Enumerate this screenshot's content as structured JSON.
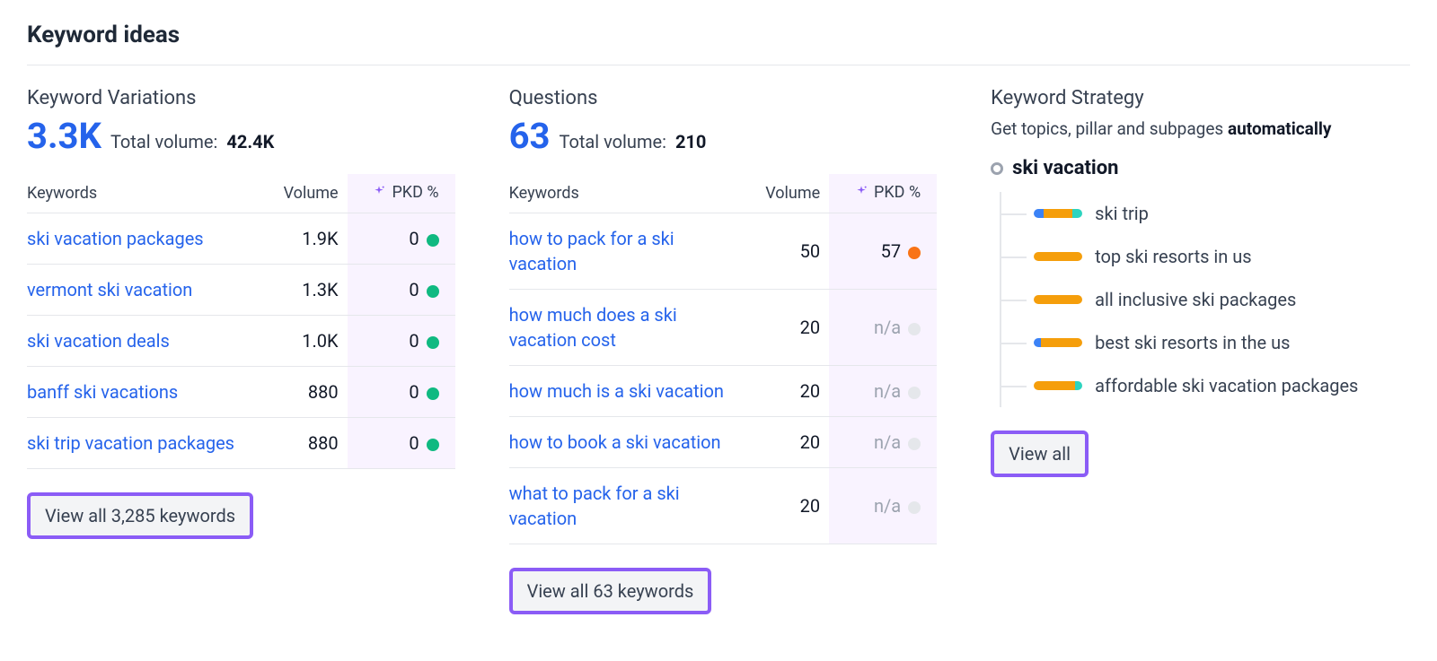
{
  "colors": {
    "dot_green": "#10b981",
    "dot_orange": "#f97316",
    "dot_gray": "#e5e7eb",
    "pkd_bg": "#f9f3ff",
    "accent_purple": "#8b5cf6",
    "link_blue": "#2563eb"
  },
  "page_title": "Keyword ideas",
  "variations": {
    "title": "Keyword Variations",
    "count": "3.3K",
    "total_label": "Total volume:",
    "total_value": "42.4K",
    "columns": {
      "keywords": "Keywords",
      "volume": "Volume",
      "pkd": "PKD %"
    },
    "rows": [
      {
        "keyword": "ski vacation packages",
        "volume": "1.9K",
        "pkd": "0",
        "dot": "green"
      },
      {
        "keyword": "vermont ski vacation",
        "volume": "1.3K",
        "pkd": "0",
        "dot": "green"
      },
      {
        "keyword": "ski vacation deals",
        "volume": "1.0K",
        "pkd": "0",
        "dot": "green"
      },
      {
        "keyword": "banff ski vacations",
        "volume": "880",
        "pkd": "0",
        "dot": "green"
      },
      {
        "keyword": "ski trip vacation packages",
        "volume": "880",
        "pkd": "0",
        "dot": "green"
      }
    ],
    "view_all": "View all 3,285 keywords"
  },
  "questions": {
    "title": "Questions",
    "count": "63",
    "total_label": "Total volume:",
    "total_value": "210",
    "columns": {
      "keywords": "Keywords",
      "volume": "Volume",
      "pkd": "PKD %"
    },
    "rows": [
      {
        "keyword": "how to pack for a ski vacation",
        "volume": "50",
        "pkd": "57",
        "dot": "orange"
      },
      {
        "keyword": "how much does a ski vacation cost",
        "volume": "20",
        "pkd": "n/a",
        "dot": "gray"
      },
      {
        "keyword": "how much is a ski vacation",
        "volume": "20",
        "pkd": "n/a",
        "dot": "gray"
      },
      {
        "keyword": "how to book a ski vacation",
        "volume": "20",
        "pkd": "n/a",
        "dot": "gray"
      },
      {
        "keyword": "what to pack for a ski vacation",
        "volume": "20",
        "pkd": "n/a",
        "dot": "gray"
      }
    ],
    "view_all": "View all 63 keywords"
  },
  "strategy": {
    "title": "Keyword Strategy",
    "subtitle_plain": "Get topics, pillar and subpages ",
    "subtitle_bold": "automatically",
    "root": "ski vacation",
    "items": [
      {
        "label": "ski trip",
        "bars": [
          20,
          60,
          20
        ]
      },
      {
        "label": "top ski resorts in us",
        "bars": [
          0,
          100,
          0
        ]
      },
      {
        "label": "all inclusive ski packages",
        "bars": [
          0,
          100,
          0
        ]
      },
      {
        "label": "best ski resorts in the us",
        "bars": [
          15,
          85,
          0
        ]
      },
      {
        "label": "affordable ski vacation packages",
        "bars": [
          0,
          85,
          15
        ]
      }
    ],
    "view_all": "View all"
  }
}
